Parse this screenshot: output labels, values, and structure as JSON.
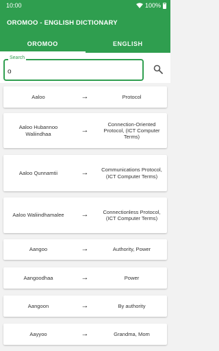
{
  "status": {
    "time": "10:00",
    "battery": "100%"
  },
  "app": {
    "title": "OROMOO - ENGLISH DICTIONARY"
  },
  "tabs": [
    {
      "label": "OROMOO"
    },
    {
      "label": "ENGLISH"
    }
  ],
  "search": {
    "label": "Search",
    "value": "o"
  },
  "entries": [
    {
      "oromo": "Aaloo",
      "english": "Protocol"
    },
    {
      "oromo": "Aaloo Hubannoo Waliindhaa",
      "english": "Connection-Oriented Protocol, (ICT Computer Terms)"
    },
    {
      "oromo": "Aaloo Qunnamtii",
      "english": "Communications Protocol, (ICT Computer Terms)"
    },
    {
      "oromo": "Aaloo Waliindhamalee",
      "english": "Connectionless Protocol, (ICT Computer Terms)"
    },
    {
      "oromo": "Aangoo",
      "english": "Authority, Power"
    },
    {
      "oromo": "Aangoodhaa",
      "english": "Power"
    },
    {
      "oromo": "Aangoon",
      "english": "By authority"
    },
    {
      "oromo": "Aayyoo",
      "english": "Grandma, Mom"
    }
  ],
  "arrow_glyph": "→",
  "colors": {
    "primary": "#2f9e4f",
    "background": "#f2f2f2",
    "card": "#ffffff"
  }
}
